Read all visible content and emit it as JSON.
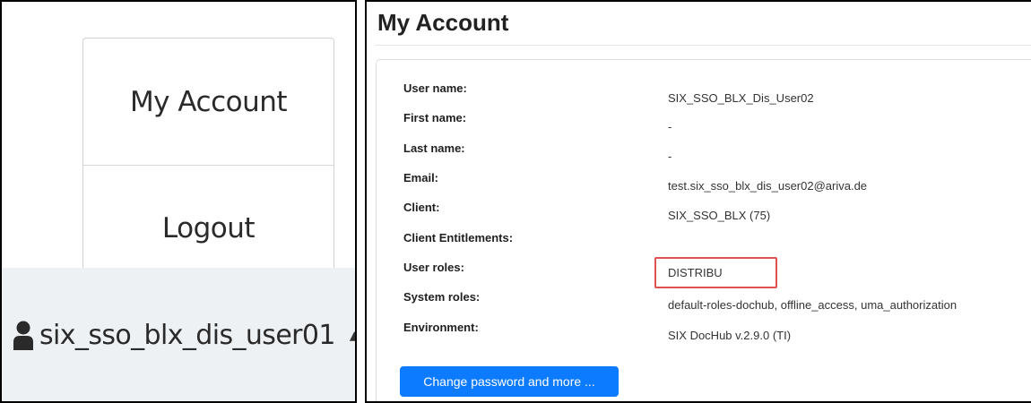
{
  "dropdown": {
    "items": [
      {
        "label": "My Account"
      },
      {
        "label": "Logout"
      }
    ]
  },
  "user_menu": {
    "username": "six_sso_blx_dis_user01",
    "user_icon": "user-icon",
    "caret_icon": "caret-up-icon"
  },
  "account": {
    "title": "My Account",
    "fields": [
      {
        "label": "User name:",
        "value": "SIX_SSO_BLX_Dis_User02"
      },
      {
        "label": "First name:",
        "value": "-"
      },
      {
        "label": "Last name:",
        "value": "-"
      },
      {
        "label": "Email:",
        "value": "test.six_sso_blx_dis_user02@ariva.de"
      },
      {
        "label": "Client:",
        "value": "SIX_SSO_BLX (75)"
      },
      {
        "label": "Client Entitlements:",
        "value": ""
      },
      {
        "label": "User roles:",
        "value": "DISTRIBU"
      },
      {
        "label": "System roles:",
        "value": "default-roles-dochub, offline_access, uma_authorization"
      },
      {
        "label": "Environment:",
        "value": "SIX DocHub v.2.9.0 (TI)"
      }
    ],
    "change_password_label": "Change password and more ..."
  },
  "colors": {
    "primary_button": "#0d7bff",
    "highlight_border": "#e05252",
    "user_bar_bg": "#eef1f3"
  }
}
